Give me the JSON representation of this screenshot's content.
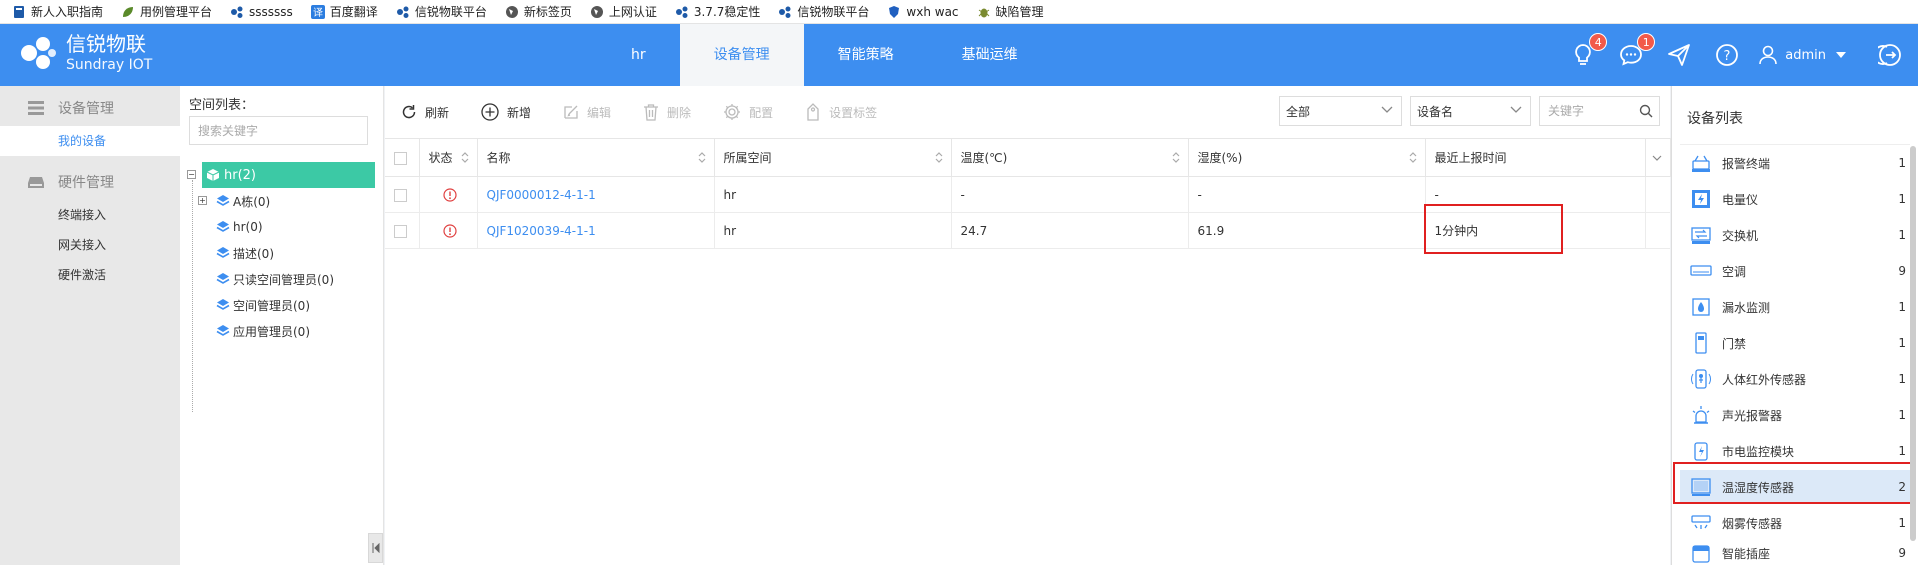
{
  "bookmarks": [
    {
      "label": "新人入职指南",
      "icon": "bookmark-icon",
      "color": "#1e5aa8"
    },
    {
      "label": "用例管理平台",
      "icon": "leaf-icon",
      "color": "#5a8a2a"
    },
    {
      "label": "sssssss",
      "icon": "cluster-icon",
      "color": "#1e5aa8"
    },
    {
      "label": "百度翻译",
      "icon": "translate-icon",
      "color": "#2b7de0"
    },
    {
      "label": "信锐物联平台",
      "icon": "cluster-icon",
      "color": "#1e5aa8"
    },
    {
      "label": "新标签页",
      "icon": "globe-icon",
      "color": "#555555"
    },
    {
      "label": "上网认证",
      "icon": "globe-icon",
      "color": "#555555"
    },
    {
      "label": "3.7.7稳定性",
      "icon": "cluster-icon",
      "color": "#1e5aa8"
    },
    {
      "label": "信锐物联平台",
      "icon": "cluster-icon",
      "color": "#1e5aa8"
    },
    {
      "label": "wxh wac",
      "icon": "shield-icon",
      "color": "#2060c0"
    },
    {
      "label": "缺陷管理",
      "icon": "bug-icon",
      "color": "#7a8a30"
    }
  ],
  "header": {
    "brand_cn": "信锐物联",
    "brand_en": "Sundray IOT",
    "nav": [
      {
        "label": "hr",
        "active": false
      },
      {
        "label": "设备管理",
        "active": true
      },
      {
        "label": "智能策略",
        "active": false
      },
      {
        "label": "基础运维",
        "active": false
      }
    ],
    "alerts_badge": "4",
    "messages_badge": "1",
    "user": "admin",
    "accent": "#3d8ef0"
  },
  "sidebar": {
    "groups": [
      {
        "label": "设备管理",
        "icon": "list-icon",
        "items": [
          {
            "label": "我的设备",
            "active": true
          }
        ]
      },
      {
        "label": "硬件管理",
        "icon": "hardware-icon",
        "items": [
          {
            "label": "终端接入",
            "active": false
          },
          {
            "label": "网关接入",
            "active": false
          },
          {
            "label": "硬件激活",
            "active": false
          }
        ]
      }
    ]
  },
  "tree": {
    "title": "空间列表：",
    "search_placeholder": "搜索关键字",
    "root": "hr(2)",
    "children": [
      "A栋(0)",
      "hr(0)",
      "描述(0)",
      "只读空间管理员(0)",
      "空间管理员(0)",
      "应用管理员(0)"
    ]
  },
  "toolbar": {
    "refresh": "刷新",
    "add": "新增",
    "edit": "编辑",
    "delete": "删除",
    "config": "配置",
    "set_tag": "设置标签",
    "filter_scope": "全部",
    "filter_field": "设备名",
    "keyword_placeholder": "关键字"
  },
  "table": {
    "columns": [
      "状态",
      "名称",
      "所属空间",
      "温度(℃)",
      "湿度(%)",
      "最近上报时间"
    ],
    "rows": [
      {
        "status": "alarm",
        "name": "QJF0000012-4-1-1",
        "space": "hr",
        "temperature": "-",
        "humidity": "-",
        "last_report": "-"
      },
      {
        "status": "alarm",
        "name": "QJF1020039-4-1-1",
        "space": "hr",
        "temperature": "24.7",
        "humidity": "61.9",
        "last_report": "1分钟内"
      }
    ]
  },
  "device_list": {
    "title": "设备列表",
    "items": [
      {
        "label": "报警终端",
        "count": "1",
        "icon": "alarm-terminal-icon"
      },
      {
        "label": "电量仪",
        "count": "1",
        "icon": "power-meter-icon"
      },
      {
        "label": "交换机",
        "count": "1",
        "icon": "switch-icon"
      },
      {
        "label": "空调",
        "count": "9",
        "icon": "air-conditioner-icon"
      },
      {
        "label": "漏水监测",
        "count": "1",
        "icon": "water-leak-icon"
      },
      {
        "label": "门禁",
        "count": "1",
        "icon": "door-access-icon"
      },
      {
        "label": "人体红外传感器",
        "count": "1",
        "icon": "infrared-sensor-icon"
      },
      {
        "label": "声光报警器",
        "count": "1",
        "icon": "siren-icon"
      },
      {
        "label": "市电监控模块",
        "count": "1",
        "icon": "mains-monitor-icon"
      },
      {
        "label": "温湿度传感器",
        "count": "2",
        "icon": "temp-humidity-icon",
        "selected": true
      },
      {
        "label": "烟雾传感器",
        "count": "1",
        "icon": "smoke-sensor-icon"
      },
      {
        "label": "智能插座",
        "count": "9",
        "icon": "smart-plug-icon"
      }
    ]
  }
}
